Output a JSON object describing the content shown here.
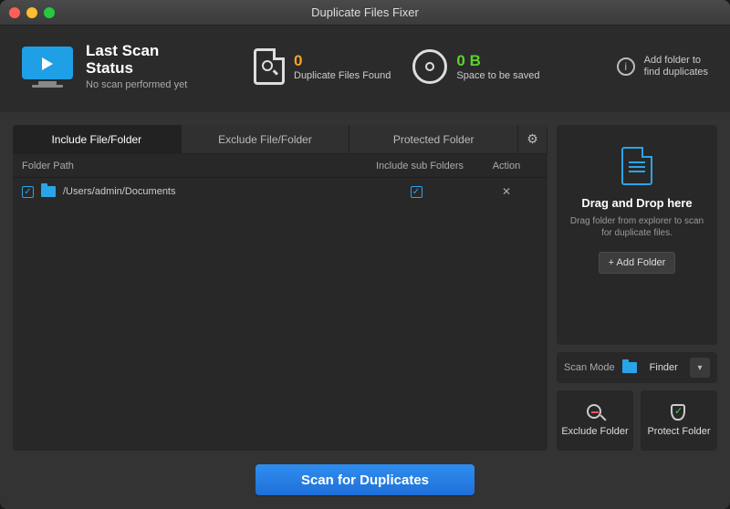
{
  "title": "Duplicate Files Fixer",
  "status": {
    "heading1": "Last Scan",
    "heading2": "Status",
    "sub": "No scan performed yet"
  },
  "stats": {
    "dupes": {
      "value": "0",
      "label": "Duplicate Files Found"
    },
    "space": {
      "value": "0 B",
      "label": "Space to be saved"
    }
  },
  "hint": {
    "line1": "Add folder to",
    "line2": "find duplicates"
  },
  "tabs": {
    "include": "Include File/Folder",
    "exclude": "Exclude File/Folder",
    "protected": "Protected Folder"
  },
  "columns": {
    "path": "Folder Path",
    "sub": "Include sub Folders",
    "action": "Action"
  },
  "rows": [
    {
      "path": "/Users/admin/Documents",
      "checked": true,
      "sub_checked": true
    }
  ],
  "drop": {
    "title": "Drag and Drop here",
    "sub": "Drag folder from explorer to scan for duplicate files.",
    "button": "+  Add Folder"
  },
  "scanmode": {
    "label": "Scan Mode",
    "value": "Finder"
  },
  "cards": {
    "exclude": "Exclude Folder",
    "protect": "Protect Folder"
  },
  "scan_button": "Scan for Duplicates"
}
